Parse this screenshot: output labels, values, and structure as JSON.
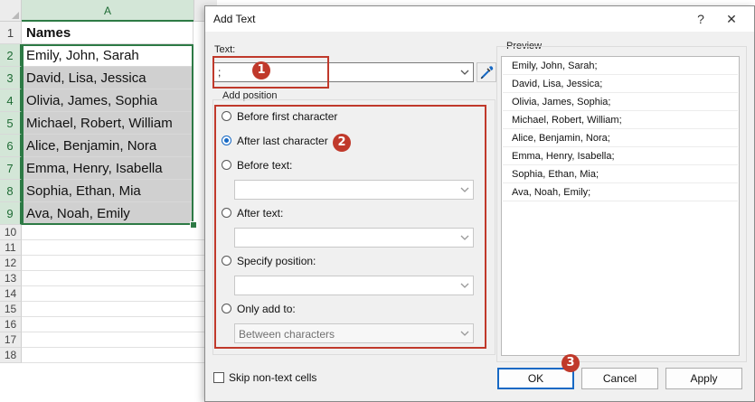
{
  "sheet": {
    "column": "A",
    "rows": [
      "1",
      "2",
      "3",
      "4",
      "5",
      "6",
      "7",
      "8",
      "9",
      "10",
      "11",
      "12",
      "13",
      "14",
      "15",
      "16",
      "17",
      "18"
    ],
    "header": "Names",
    "cells": [
      "Emily, John, Sarah",
      "David, Lisa, Jessica",
      "Olivia, James, Sophia",
      "Michael, Robert, William",
      "Alice, Benjamin, Nora",
      "Emma, Henry, Isabella",
      "Sophia, Ethan, Mia",
      "Ava, Noah, Emily"
    ]
  },
  "dialog": {
    "title": "Add Text",
    "help": "?",
    "close": "✕",
    "text_label": "Text:",
    "text_value": ";",
    "add_position_label": "Add position",
    "options": [
      "Before first character",
      "After last character",
      "Before text:",
      "After text:",
      "Specify position:",
      "Only add to:"
    ],
    "selected_option": "After last character",
    "only_add_to_value": "Between characters",
    "preview_label": "Preview",
    "preview": [
      "Emily, John, Sarah;",
      "David, Lisa, Jessica;",
      "Olivia, James, Sophia;",
      "Michael, Robert, William;",
      "Alice, Benjamin, Nora;",
      "Emma, Henry, Isabella;",
      "Sophia, Ethan, Mia;",
      "Ava, Noah, Emily;"
    ],
    "skip_non_text": "Skip non-text cells",
    "buttons": {
      "ok": "OK",
      "cancel": "Cancel",
      "apply": "Apply"
    }
  },
  "annotations": {
    "step1": "1",
    "step2": "2",
    "step3": "3"
  },
  "colors": {
    "accent": "#1769c4",
    "annotation": "#c0392b",
    "sheet_selection": "#2d7a45"
  },
  "icons": [
    "dropdown-chevron-icon",
    "eyedropper-icon",
    "help-icon",
    "close-icon"
  ]
}
